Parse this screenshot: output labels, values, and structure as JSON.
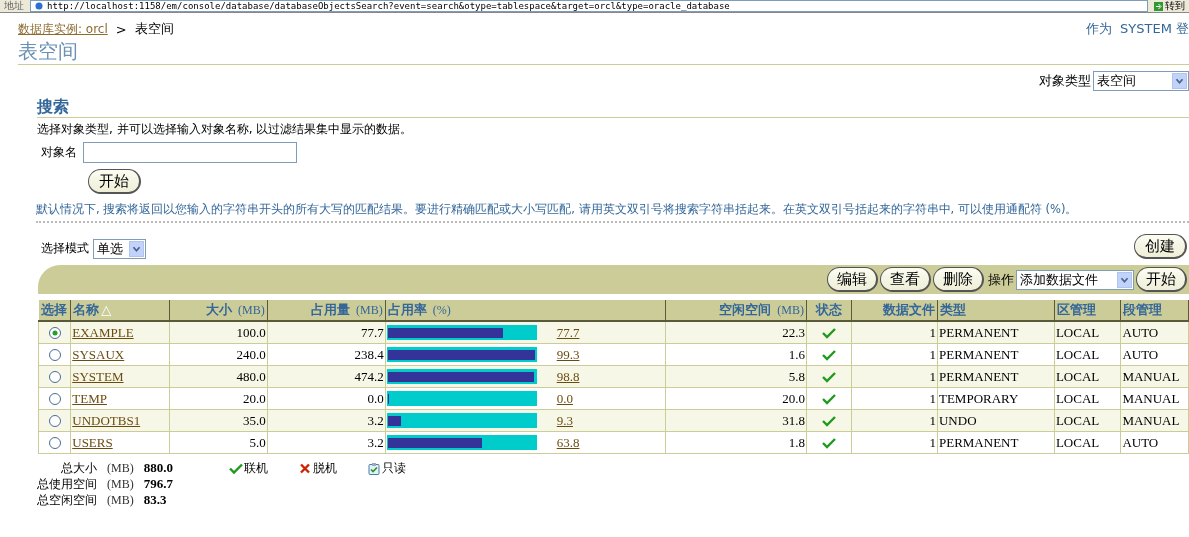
{
  "browser": {
    "address_label": "地址",
    "url": "http://localhost:1158/em/console/database/databaseObjectsSearch?event=search&otype=tablespace&target=orcl&type=oracle_database",
    "go_button": "转到"
  },
  "breadcrumb": {
    "link": "数据库实例: orcl",
    "separator": ">",
    "current": "表空间"
  },
  "user_info": "作为  SYSTEM 登",
  "page_title": "表空间",
  "object_type": {
    "label": "对象类型",
    "value": "表空间"
  },
  "search": {
    "title": "搜索",
    "description": "选择对象类型, 并可以选择输入对象名称, 以过滤结果集中显示的数据。",
    "name_label": "对象名",
    "go_button": "开始",
    "hint": "默认情况下, 搜索将返回以您输入的字符串开头的所有大写的匹配结果。要进行精确匹配或大小写匹配, 请用英文双引号将搜索字符串括起来。在英文双引号括起来的字符串中, 可以使用通配符 (%)。"
  },
  "selection_mode": {
    "label": "选择模式",
    "value": "单选"
  },
  "create_button": "创建",
  "actions": {
    "buttons": [
      "编辑",
      "查看",
      "删除"
    ],
    "label": "操作",
    "value": "添加数据文件",
    "go_button": "开始"
  },
  "table": {
    "columns": [
      {
        "label": "选择"
      },
      {
        "label": "名称",
        "sort_mark": "△"
      },
      {
        "label": "大小",
        "unit": "(MB)"
      },
      {
        "label": "占用量",
        "unit": "(MB)"
      },
      {
        "label": "占用率",
        "unit": "(%)"
      },
      {
        "label": "空闲空间",
        "unit": "(MB)"
      },
      {
        "label": "状态"
      },
      {
        "label": "数据文件"
      },
      {
        "label": "类型"
      },
      {
        "label": "区管理"
      },
      {
        "label": "段管理"
      }
    ],
    "rows": [
      {
        "selected": true,
        "name": "EXAMPLE",
        "size": "100.0",
        "used": "77.7",
        "level": 0.777,
        "percent": "77.7",
        "free": "22.3",
        "online": true,
        "datafiles": "1",
        "type": "PERMANENT",
        "extent": "LOCAL",
        "segment": "AUTO"
      },
      {
        "selected": false,
        "name": "SYSAUX",
        "size": "240.0",
        "used": "238.4",
        "level": 0.993,
        "percent": "99.3",
        "free": "1.6",
        "online": true,
        "datafiles": "1",
        "type": "PERMANENT",
        "extent": "LOCAL",
        "segment": "AUTO"
      },
      {
        "selected": false,
        "name": "SYSTEM",
        "size": "480.0",
        "used": "474.2",
        "level": 0.988,
        "percent": "98.8",
        "free": "5.8",
        "online": true,
        "datafiles": "1",
        "type": "PERMANENT",
        "extent": "LOCAL",
        "segment": "MANUAL"
      },
      {
        "selected": false,
        "name": "TEMP",
        "size": "20.0",
        "used": "0.0",
        "level": 0,
        "percent": "0.0",
        "free": "20.0",
        "online": true,
        "datafiles": "1",
        "type": "TEMPORARY",
        "extent": "LOCAL",
        "segment": "MANUAL"
      },
      {
        "selected": false,
        "name": "UNDOTBS1",
        "size": "35.0",
        "used": "3.2",
        "level": 0.093,
        "percent": "9.3",
        "free": "31.8",
        "online": true,
        "datafiles": "1",
        "type": "UNDO",
        "extent": "LOCAL",
        "segment": "MANUAL"
      },
      {
        "selected": false,
        "name": "USERS",
        "size": "5.0",
        "used": "3.2",
        "level": 0.638,
        "percent": "63.8",
        "free": "1.8",
        "online": true,
        "datafiles": "1",
        "type": "PERMANENT",
        "extent": "LOCAL",
        "segment": "AUTO"
      }
    ]
  },
  "totals": [
    {
      "label": "总大小",
      "unit": "(MB)",
      "value": "880.0"
    },
    {
      "label": "总使用空间",
      "unit": "(MB)",
      "value": "796.7"
    },
    {
      "label": "总空闲空间",
      "unit": "(MB)",
      "value": "83.3"
    }
  ],
  "legend": [
    {
      "kind": "online",
      "label": "联机"
    },
    {
      "kind": "offline",
      "label": "脱机"
    },
    {
      "kind": "readonly",
      "label": "只读"
    }
  ]
}
